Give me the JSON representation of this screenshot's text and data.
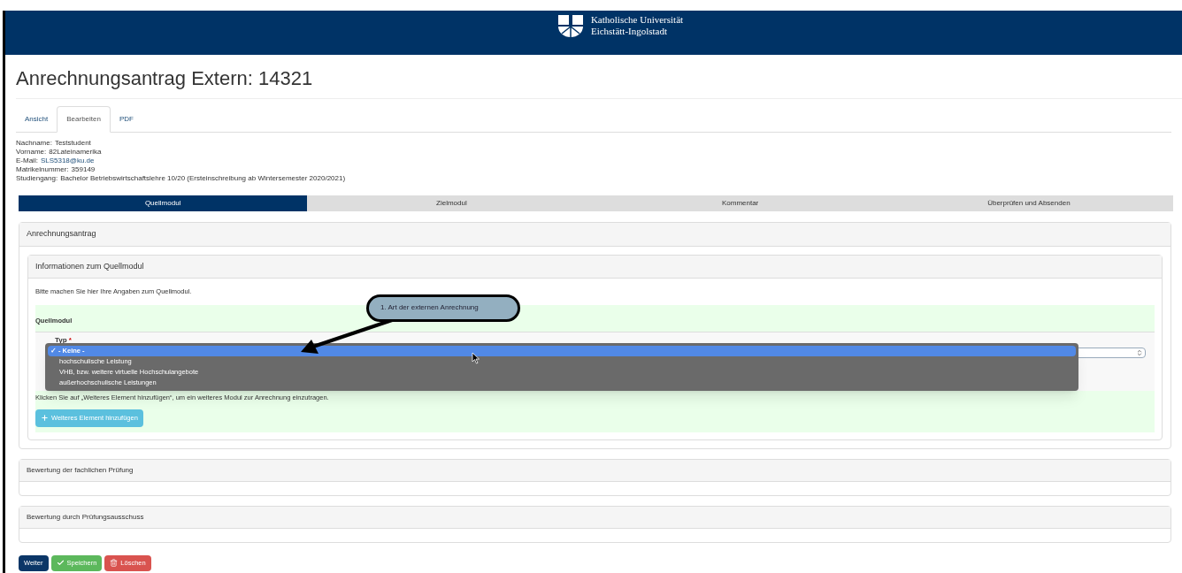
{
  "header": {
    "logo_line_1": "Katholische Universität",
    "logo_line_2": "Eichstätt-Ingolstadt"
  },
  "title": "Anrechnungsantrag Extern: 14321",
  "tabs": [
    {
      "label": "Ansicht",
      "selected": false
    },
    {
      "label": "Bearbeiten",
      "selected": true
    },
    {
      "label": "PDF",
      "selected": false
    }
  ],
  "student_info": [
    {
      "label": "Nachname:",
      "value": "Teststudent",
      "kind": "text"
    },
    {
      "label": "Vorname:",
      "value": "82Lateinamerika",
      "kind": "text"
    },
    {
      "label": "E-Mail:",
      "value": "SLS5318@ku.de",
      "kind": "link"
    },
    {
      "label": "Matrikelnummer:",
      "value": "359149",
      "kind": "text"
    },
    {
      "label": "Studiengang:",
      "value": "Bachelor Betriebswirtschaftslehre 10/20 (Ersteinschreibung ab Wintersemester 2020/2021)",
      "kind": "text"
    }
  ],
  "steps": [
    {
      "label": "Quellmodul",
      "selected": true
    },
    {
      "label": "Zielmodul",
      "selected": false
    },
    {
      "label": "Kommentar",
      "selected": false
    },
    {
      "label": "Überprüfen und Absenden",
      "selected": false
    }
  ],
  "main_panel": {
    "title": "Anrechnungsantrag",
    "sub_panel": {
      "title": "Informationen zum Quellmodul",
      "intro": "Bitte machen Sie hier Ihre Angaben zum Quellmodul.",
      "section_title": "Quellmodul",
      "field_label": "Typ",
      "required_mark": "*",
      "hint": "Klicken Sie auf „Weiteres Element hinzufügen“, um ein weiteres Modul zur Anrechnung einzutragen.",
      "add_button": "Weiteres Element hinzufügen"
    }
  },
  "dropdown": {
    "options": [
      {
        "label": "- Keine -",
        "selected": true,
        "checkmark": "✓"
      },
      {
        "label": "hochschulische Leistung",
        "selected": false
      },
      {
        "label": "VHB, bzw. weitere virtuelle Hochschulangebote",
        "selected": false
      },
      {
        "label": "außerhochschulische Leistungen",
        "selected": false
      }
    ]
  },
  "callout": {
    "text": "1. Art der externen Anrechnung"
  },
  "panels": [
    {
      "title": "Bewertung der fachlichen Prüfung"
    },
    {
      "title": "Bewertung durch Prüfungsausschuss"
    }
  ],
  "buttons": [
    {
      "label": "Weiter",
      "kind": "primary"
    },
    {
      "label": "Speichern",
      "kind": "save"
    },
    {
      "label": "Löschen",
      "kind": "delete"
    }
  ]
}
